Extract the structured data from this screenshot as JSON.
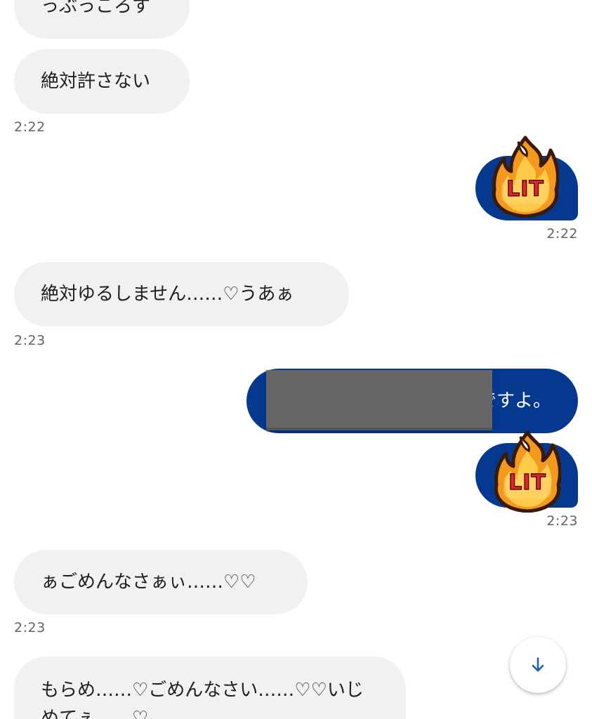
{
  "messages": [
    {
      "text": "っぶっころす"
    },
    {
      "text": "絶対許さない"
    },
    {
      "text": "絶対ゆるしません……♡うあぁ"
    },
    {
      "text": "ですよ。"
    },
    {
      "text": "ぁごめんなさぁぃ……♡♡"
    },
    {
      "text": "もらめ……♡ごめんなさい……♡♡いじめてぇ……♡"
    }
  ],
  "timestamps": {
    "t1": "2:22",
    "t2": "2:22",
    "t3": "2:23",
    "t4": "2:23",
    "t5": "2:23"
  },
  "stickers": {
    "lit_text": "LIT"
  },
  "icons": {
    "scroll_down": "arrow-down-icon",
    "sticker": "fire-lit-icon"
  },
  "colors": {
    "incoming_bubble": "#eff1f3",
    "outgoing_bubble": "#05398f",
    "accent": "#1a5fb4"
  }
}
